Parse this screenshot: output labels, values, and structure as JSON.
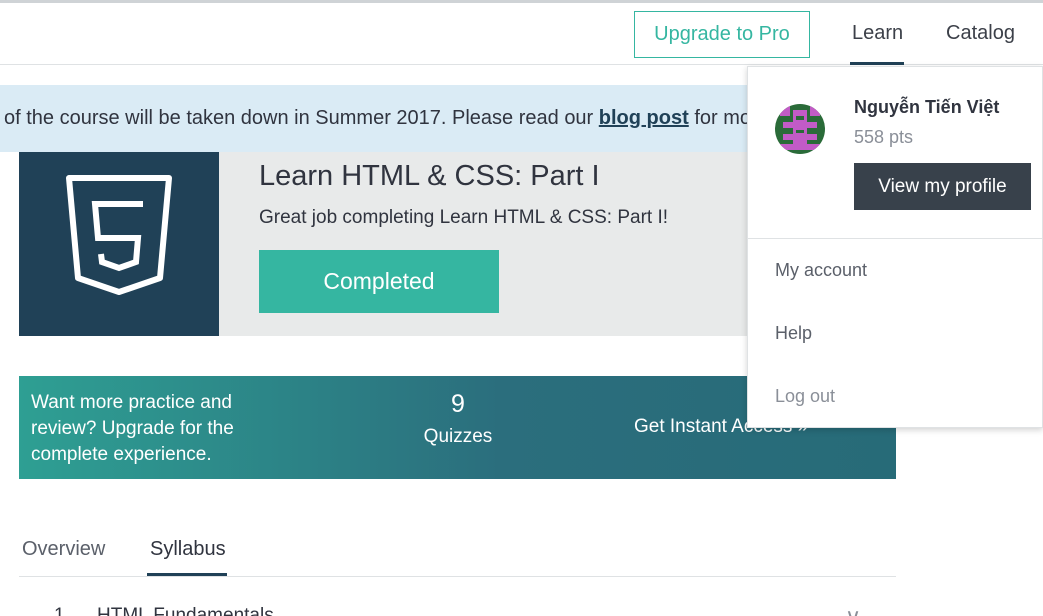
{
  "header": {
    "upgrade_label": "Upgrade to Pro",
    "nav": {
      "learn": "Learn",
      "catalog": "Catalog"
    }
  },
  "banner": {
    "text_before": "of the course will be taken down in Summer 2017. Please read our ",
    "link": "blog post",
    "text_after": " for more"
  },
  "course": {
    "logo_icon": "html5-icon",
    "title": "Learn HTML & CSS: Part I",
    "subtitle": "Great job completing Learn HTML & CSS: Part I!",
    "status_button": "Completed"
  },
  "promo": {
    "text": "Want more practice and review? Upgrade for the complete experience.",
    "count": "9",
    "count_label": "Quizzes",
    "cta": "Get Instant Access »"
  },
  "tabs": {
    "overview": "Overview",
    "syllabus": "Syllabus",
    "active": "Syllabus"
  },
  "syllabus": [
    {
      "number": "1",
      "title": "HTML Fundamentals"
    }
  ],
  "dropdown": {
    "user_name": "Nguyễn Tiến Việt",
    "points": "558 pts",
    "profile_button": "View my profile",
    "items": {
      "account": "My account",
      "help": "Help",
      "logout": "Log out"
    }
  },
  "colors": {
    "brand_teal": "#35b6a1",
    "navy": "#204157",
    "banner_bg": "#daebf5",
    "dark_button": "#38414b"
  }
}
